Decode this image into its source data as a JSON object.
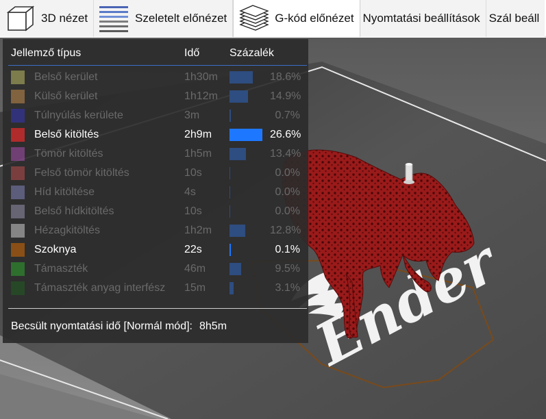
{
  "tabs": [
    {
      "label": "3D nézet",
      "icon": "cube-icon",
      "active": false
    },
    {
      "label": "Szeletelt előnézet",
      "icon": "sliced-layers-icon",
      "active": false
    },
    {
      "label": "G-kód előnézet",
      "icon": "gcode-layers-icon",
      "active": true
    },
    {
      "label": "Nyomtatási beállítások",
      "active": false
    },
    {
      "label": "Szál beáll",
      "active": false
    }
  ],
  "legend": {
    "headers": {
      "feature": "Jellemző típus",
      "time": "Idő",
      "percent": "Százalék"
    },
    "rows": [
      {
        "name": "Belső kerület",
        "time": "1h30m",
        "percent": "18.6%",
        "value": 18.6,
        "color": "#e6e676",
        "visible": false
      },
      {
        "name": "Külső kerület",
        "time": "1h12m",
        "percent": "14.9%",
        "value": 14.9,
        "color": "#f3ac55",
        "visible": false
      },
      {
        "name": "Túlnyúlás kerülete",
        "time": "3m",
        "percent": "0.7%",
        "value": 0.7,
        "color": "#3a3ae6",
        "visible": false
      },
      {
        "name": "Belső kitöltés",
        "time": "2h9m",
        "percent": "26.6%",
        "value": 26.6,
        "color": "#b02b2b",
        "visible": true
      },
      {
        "name": "Tömör kitöltés",
        "time": "1h5m",
        "percent": "13.4%",
        "value": 13.4,
        "color": "#cc58d6",
        "visible": false
      },
      {
        "name": "Felső tömör kitöltés",
        "time": "10s",
        "percent": "0.0%",
        "value": 0.0,
        "color": "#e85656",
        "visible": false
      },
      {
        "name": "Híd kitöltése",
        "time": "4s",
        "percent": "0.0%",
        "value": 0.0,
        "color": "#9d9de6",
        "visible": false
      },
      {
        "name": "Belső hídkitöltés",
        "time": "10s",
        "percent": "0.0%",
        "value": 0.0,
        "color": "#b7b0d7",
        "visible": false
      },
      {
        "name": "Hézagkitöltés",
        "time": "1h2m",
        "percent": "12.8%",
        "value": 12.8,
        "color": "#ffffff",
        "visible": false
      },
      {
        "name": "Szoknya",
        "time": "22s",
        "percent": "0.1%",
        "value": 0.1,
        "color": "#8a4f16",
        "visible": true
      },
      {
        "name": "Támaszték",
        "time": "46m",
        "percent": "9.5%",
        "value": 9.5,
        "color": "#2fca2f",
        "visible": false
      },
      {
        "name": "Támaszték anyag interfész",
        "time": "15m",
        "percent": "3.1%",
        "value": 3.1,
        "color": "#1d6d1d",
        "visible": false
      }
    ],
    "estimate_label": "Becsült nyomtatási idő [Normál mód]:",
    "estimate_value": "8h5m"
  },
  "viewport": {
    "plate_text": "Ender",
    "model_color": "#8a1414",
    "skirt_color": "#7a4a1a"
  }
}
